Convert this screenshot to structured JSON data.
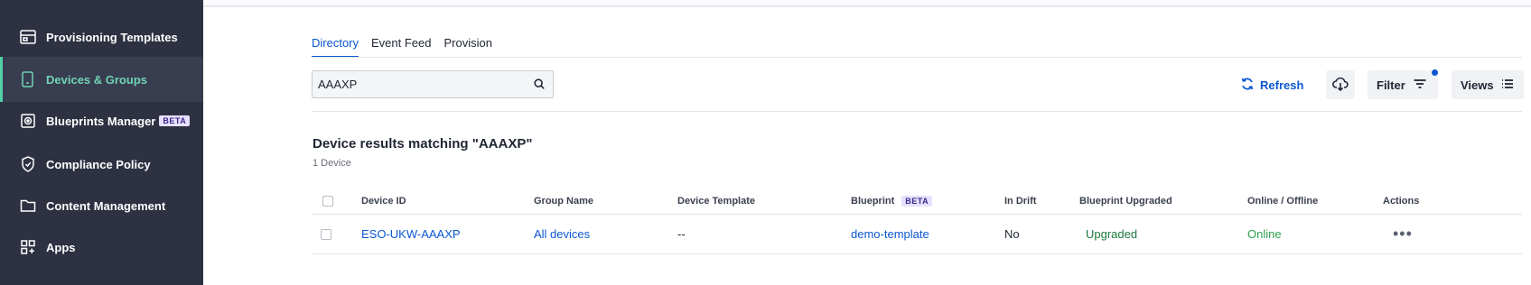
{
  "sidebar": {
    "items": [
      {
        "label": "Provisioning Templates",
        "icon": "template-icon"
      },
      {
        "label": "Devices & Groups",
        "icon": "devices-icon",
        "active": true
      },
      {
        "label": "Blueprints Manager",
        "icon": "blueprint-icon",
        "badge": "BETA"
      },
      {
        "label": "Compliance Policy",
        "icon": "shield-icon"
      },
      {
        "label": "Content Management",
        "icon": "folder-icon"
      },
      {
        "label": "Apps",
        "icon": "apps-icon"
      }
    ]
  },
  "tabs": [
    {
      "label": "Directory",
      "active": true
    },
    {
      "label": "Event Feed"
    },
    {
      "label": "Provision"
    }
  ],
  "search": {
    "value": "AAAXP"
  },
  "toolbar": {
    "refresh_label": "Refresh",
    "filter_label": "Filter",
    "views_label": "Views"
  },
  "results": {
    "title": "Device results matching \"AAAXP\"",
    "count": "1 Device"
  },
  "table": {
    "headers": {
      "device_id": "Device ID",
      "group_name": "Group Name",
      "device_template": "Device Template",
      "blueprint": "Blueprint",
      "blueprint_badge": "BETA",
      "in_drift": "In Drift",
      "blueprint_upgraded": "Blueprint Upgraded",
      "online_offline": "Online / Offline",
      "actions": "Actions"
    },
    "rows": [
      {
        "device_id": "ESO-UKW-AAAXP",
        "group_name": "All devices",
        "device_template": "--",
        "blueprint": "demo-template",
        "in_drift": "No",
        "blueprint_upgraded": "Upgraded",
        "online_offline": "Online",
        "actions": "•••"
      }
    ]
  },
  "colors": {
    "sidebar_bg": "#2d3142",
    "accent": "#0b57d0",
    "active_nav": "#6fd3b4",
    "online": "#2ea04f"
  }
}
